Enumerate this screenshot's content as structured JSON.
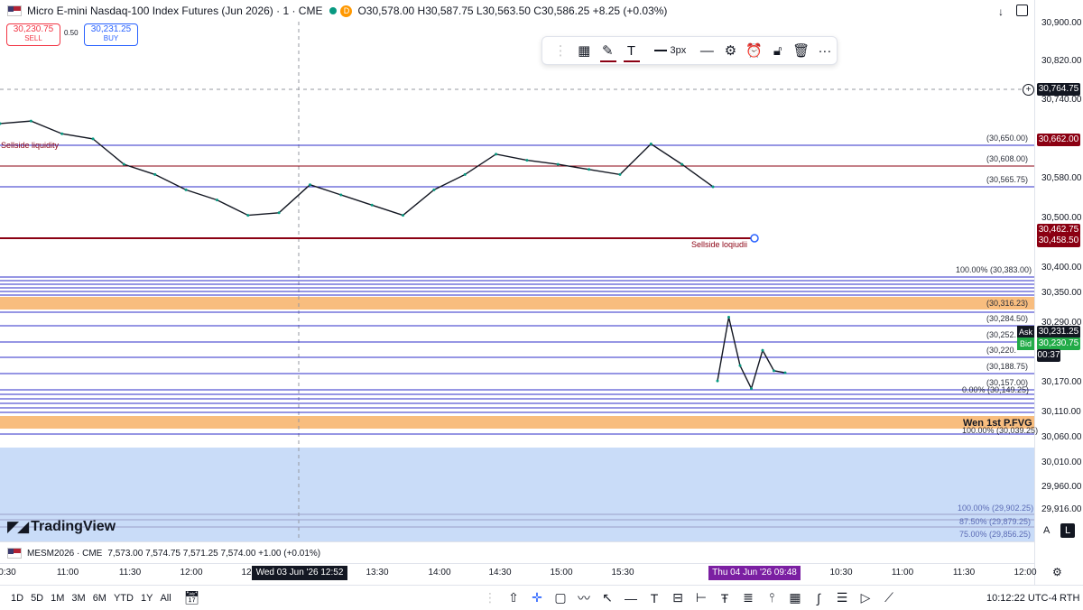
{
  "header": {
    "symbol_title": "Micro E-mini Nasdaq-100 Index Futures (Jun 2026) · 1 · CME",
    "badge": "D",
    "ohlc": "O30,578.00 H30,587.75 L30,563.50 C30,586.25 +8.25 (+0.03%)",
    "sell_price": "30,230.75",
    "sell_label": "SELL",
    "spread": "0.50",
    "buy_price": "30,231.25",
    "buy_label": "BUY"
  },
  "drawing_toolbar": {
    "width_label": "3px"
  },
  "second_pane": {
    "symbol": "MESM2026 · CME",
    "ohlc": "7,573.00 7,574.75 7,571.25 7,574.00 +1.00 (+0.01%)"
  },
  "watermark": "TradingView",
  "price_axis": {
    "ticks": [
      "30,900.00",
      "30,820.00",
      "30,740.00",
      "30,580.00",
      "30,500.00",
      "30,400.00",
      "30,350.00",
      "30,290.00",
      "30,170.00",
      "30,110.00",
      "30,060.00",
      "30,010.00",
      "29,960.00",
      "29,916.00"
    ],
    "crosshair_price": "30,764.75",
    "tags": {
      "level_red": "30,662.00",
      "line_a": "30,462.75",
      "line_b": "30,458.50",
      "ask_label": "Ask",
      "ask": "30,231.25",
      "bid_label": "Bid",
      "bid": "30,230.75",
      "countdown": "00:37"
    },
    "axis_buttons": {
      "auto_scale": "A",
      "log_scale": "L"
    }
  },
  "level_labels": {
    "l1": "(30,650.00)",
    "l2": "(30,608.00)",
    "l3": "(30,565.75)",
    "fib_top": "100.00% (30,383.00)",
    "l_316": "(30,316.23)",
    "l_284": "(30,284.50)",
    "l_252": "(30,252.",
    "l_220": "(30,220.",
    "l_188": "(30,188.75)",
    "l_157": "(30,157.00)",
    "fib_zero": "0.00% (30,149.25)",
    "fib_bottom": "100.00% (30,039.25)",
    "fvg": "Wen 1st P.FVG",
    "fib2_100": "100.00% (29,902.25)",
    "fib2_875": "87.50% (29,879.25)",
    "fib2_75": "75.00% (29,856.25)"
  },
  "annotations": {
    "sellside_left": "Sellside liquidity",
    "sellside_right": "Sellside loqiudii"
  },
  "time_axis": {
    "ticks": [
      "0:30",
      "11:00",
      "11:30",
      "12:00",
      "12",
      "13:30",
      "14:00",
      "14:30",
      "15:00",
      "15:30",
      "10:30",
      "11:00",
      "11:30",
      "12:00"
    ],
    "highlight_1": "Wed 03 Jun '26   12:52",
    "highlight_2": "Thu 04 Jun '26   09:48"
  },
  "bottom_bar": {
    "ranges": [
      "1D",
      "5D",
      "1M",
      "3M",
      "6M",
      "YTD",
      "1Y",
      "All"
    ],
    "clock": "10:12:22 UTC-4",
    "session": "RTH"
  },
  "colors": {
    "up": "#089981",
    "down": "#131722",
    "level_blue": "#2c2cc8",
    "level_red": "#8b0012",
    "zone_orange": "#f7b267",
    "zone_blue": "#c9dcf8",
    "highlight": "#7b1fa2"
  },
  "chart_data": {
    "type": "line",
    "series": [
      {
        "x": [
          "10:30",
          "10:45",
          "11:00",
          "11:15",
          "11:30",
          "11:45",
          "12:00",
          "12:15",
          "12:30",
          "12:45",
          "13:00",
          "13:15",
          "13:30",
          "13:45",
          "14:00",
          "14:15",
          "14:30",
          "14:45",
          "15:00",
          "15:15",
          "15:30",
          "15:45",
          "16:00",
          "16:15"
        ],
        "values": [
          30720,
          30725,
          30700,
          30690,
          30640,
          30620,
          30590,
          30570,
          30540,
          30545,
          30600,
          30580,
          30560,
          30540,
          30590,
          30620,
          30660,
          30648,
          30640,
          30630,
          30620,
          30680,
          30640,
          30596
        ]
      },
      {
        "x": [
          "09:30",
          "09:35",
          "09:40",
          "09:45",
          "09:50",
          "09:55",
          "10:00"
        ],
        "values": [
          30215,
          30340,
          30245,
          30200,
          30275,
          30235,
          30231
        ]
      }
    ],
    "ylim": [
      29900,
      30920
    ],
    "grid": false
  }
}
